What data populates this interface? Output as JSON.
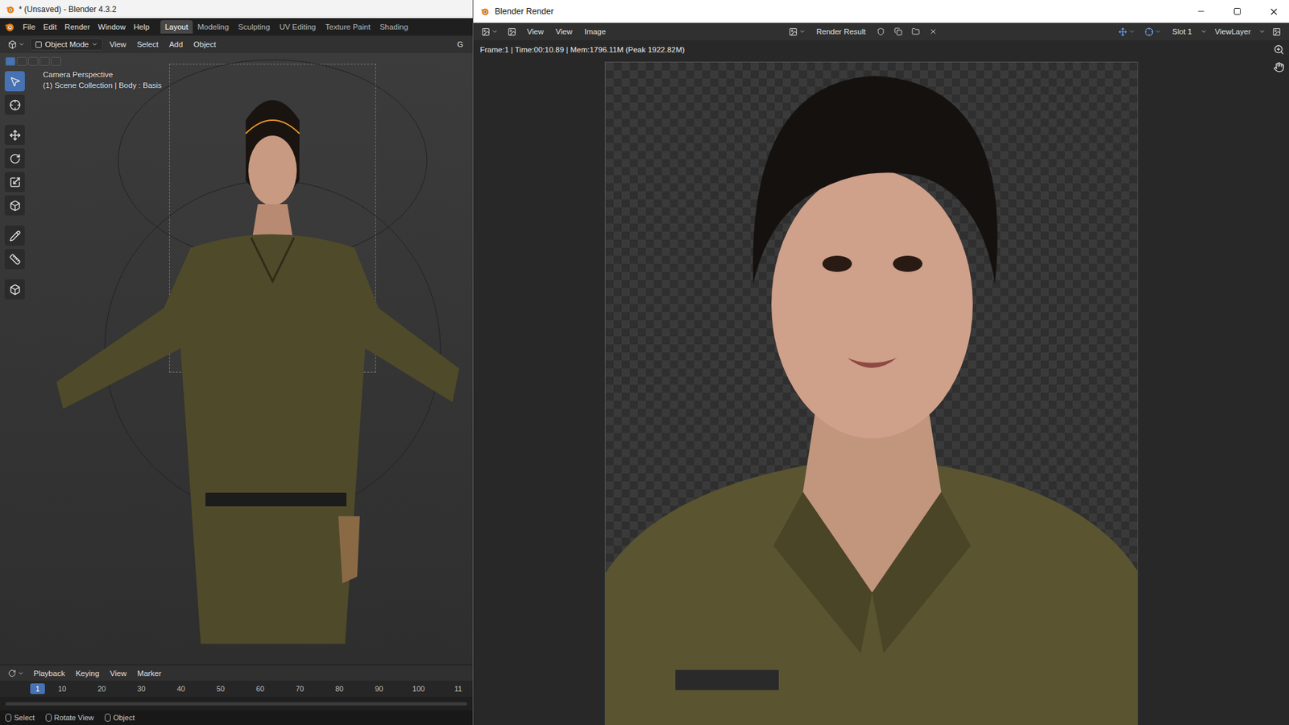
{
  "main_window": {
    "title": "* (Unsaved) - Blender 4.3.2"
  },
  "menu": [
    "File",
    "Edit",
    "Render",
    "Window",
    "Help"
  ],
  "workspace_tabs": [
    {
      "label": "Layout",
      "selected": true
    },
    {
      "label": "Modeling",
      "selected": false
    },
    {
      "label": "Sculpting",
      "selected": false
    },
    {
      "label": "UV Editing",
      "selected": false
    },
    {
      "label": "Texture Paint",
      "selected": false
    },
    {
      "label": "Shading",
      "selected": false
    }
  ],
  "viewport": {
    "mode": "Object Mode",
    "menus": [
      "View",
      "Select",
      "Add",
      "Object"
    ],
    "right_label": "G",
    "overlay": [
      "Camera Perspective",
      "(1) Scene Collection | Body : Basis"
    ]
  },
  "select_modes": [
    {
      "selected": true
    },
    {
      "selected": false
    },
    {
      "selected": false
    },
    {
      "selected": false
    },
    {
      "selected": false
    }
  ],
  "tools": [
    {
      "kind": "select",
      "selected": true
    },
    {
      "kind": "cursor",
      "selected": false
    },
    {
      "kind": "move",
      "selected": false
    },
    {
      "kind": "rotate",
      "selected": false
    },
    {
      "kind": "scale",
      "selected": false
    },
    {
      "kind": "transform",
      "selected": false
    },
    {
      "kind": "annotate",
      "selected": false
    },
    {
      "kind": "measure",
      "selected": false
    },
    {
      "kind": "add-cube",
      "selected": false
    }
  ],
  "timeline": {
    "menus": [
      "Playback",
      "Keying",
      "View",
      "Marker"
    ],
    "current_frame": "1",
    "frames": [
      "10",
      "20",
      "30",
      "40",
      "50",
      "60",
      "70",
      "80",
      "90",
      "100",
      "11"
    ]
  },
  "status_bar": [
    "Select",
    "Rotate View",
    "Object"
  ],
  "render_window": {
    "title": "Blender Render",
    "menus": [
      "View",
      "View",
      "Image"
    ],
    "image_name": "Render Result",
    "slot": "Slot 1",
    "view_layer": "ViewLayer",
    "info": "Frame:1 | Time:00:10.89 | Mem:1796.11M (Peak 1922.82M)"
  }
}
